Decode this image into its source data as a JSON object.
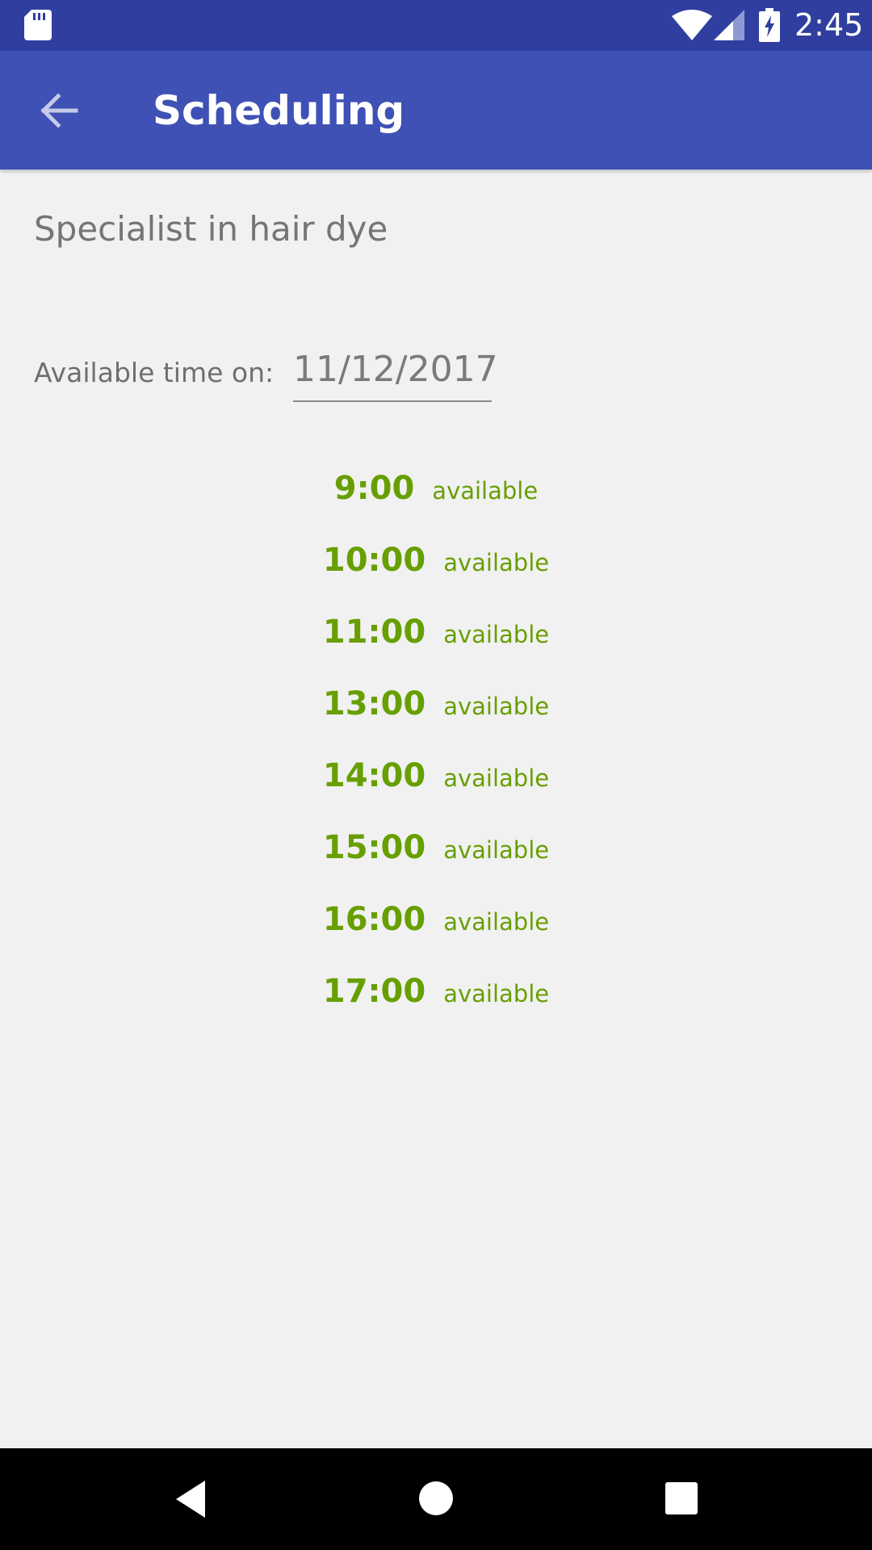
{
  "status_bar": {
    "time": "2:45",
    "icons": [
      "sd-card-icon",
      "wifi-icon",
      "cell-signal-icon",
      "battery-charging-icon"
    ]
  },
  "app_bar": {
    "title": "Scheduling",
    "back_icon": "arrow-back-icon"
  },
  "main": {
    "subtitle": "Specialist in hair dye",
    "date_label": "Available time on:",
    "date_value": "11/12/2017",
    "slots": [
      {
        "time": "9:00",
        "status": "available"
      },
      {
        "time": "10:00",
        "status": "available"
      },
      {
        "time": "11:00",
        "status": "available"
      },
      {
        "time": "13:00",
        "status": "available"
      },
      {
        "time": "14:00",
        "status": "available"
      },
      {
        "time": "15:00",
        "status": "available"
      },
      {
        "time": "16:00",
        "status": "available"
      },
      {
        "time": "17:00",
        "status": "available"
      }
    ]
  },
  "nav_bar": {
    "icons": [
      "nav-back-icon",
      "nav-home-icon",
      "nav-recents-icon"
    ]
  },
  "colors": {
    "status_bar": "#303f9f",
    "app_bar": "#3f51b5",
    "background": "#f1f1f1",
    "available": "#689f00",
    "nav_bar": "#000000"
  }
}
